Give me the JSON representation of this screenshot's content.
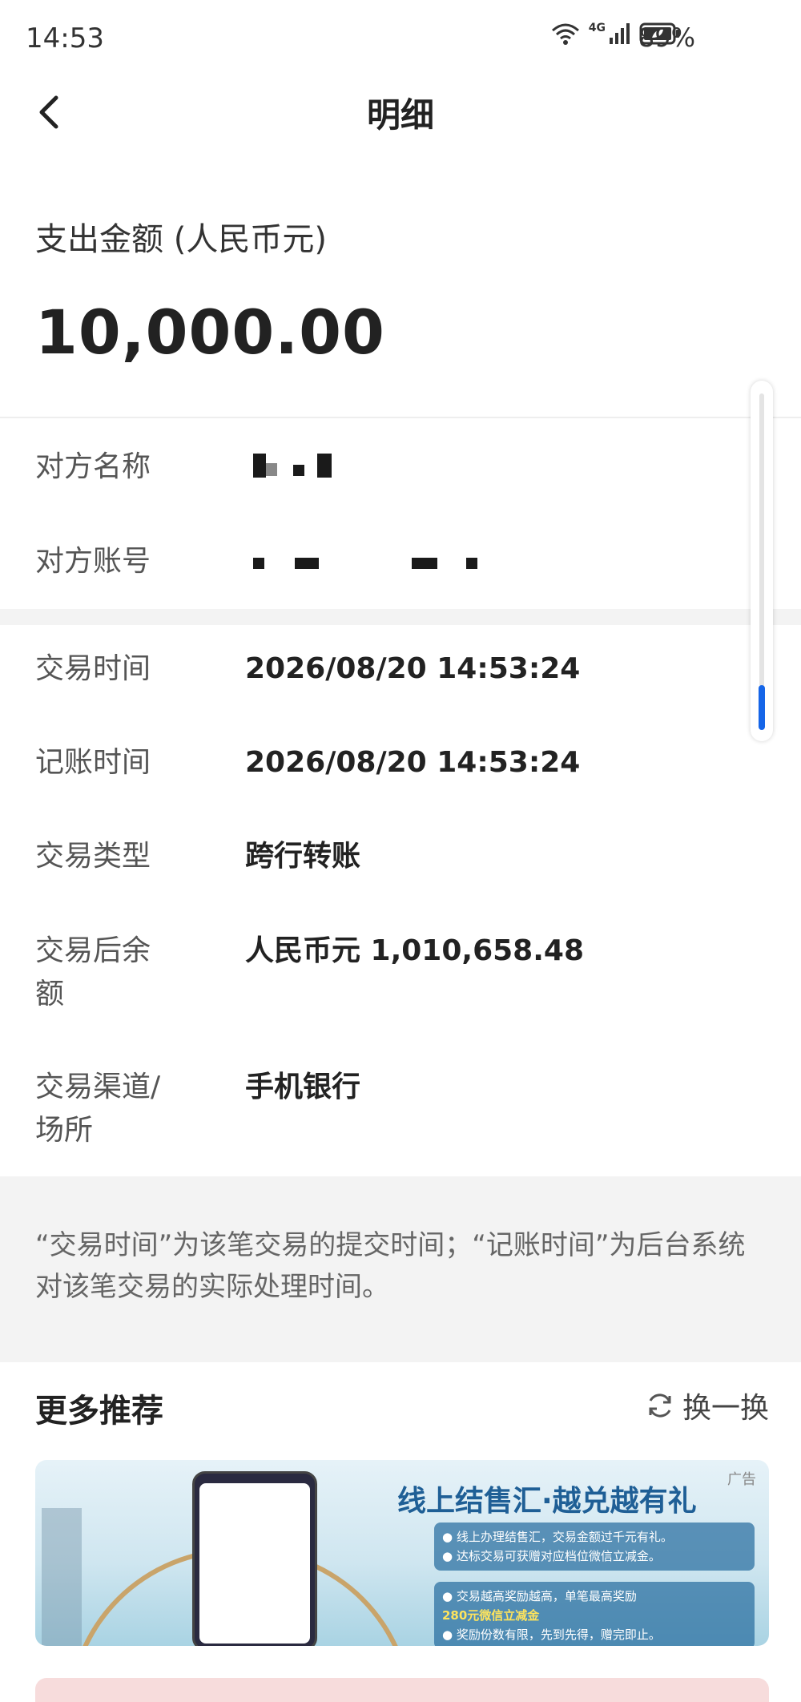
{
  "status_bar": {
    "time": "14:53",
    "network": "4G",
    "battery_percent": "89%"
  },
  "header": {
    "title": "明细"
  },
  "amount": {
    "label": "支出金额 (人民币元)",
    "value": "10,000.00"
  },
  "details": [
    {
      "label": "对方名称",
      "value": ""
    },
    {
      "label": "对方账号",
      "value": ""
    },
    {
      "label": "交易时间",
      "value": "2026/08/20 14:53:24"
    },
    {
      "label": "记账时间",
      "value": "2026/08/20 14:53:24"
    },
    {
      "label": "交易类型",
      "value": "跨行转账"
    },
    {
      "label": "交易后余额",
      "value": "人民币元 1,010,658.48"
    },
    {
      "label": "交易渠道/场所",
      "value": "手机银行"
    }
  ],
  "note": "“交易时间”为该笔交易的提交时间；“记账时间”为后台系统对该笔交易的实际处理时间。",
  "recommend": {
    "title": "更多推荐",
    "refresh_label": "换一换",
    "banner": {
      "ad_tag": "广告",
      "headline": "线上结售汇·越兑越有礼",
      "box1_line1": "● 线上办理结售汇，交易金额过千元有礼。",
      "box1_line2": "● 达标交易可获赠对应档位微信立减金。",
      "box2_line1": "● 交易越高奖励越高，单笔最高奖励",
      "box2_highlight": "280元微信立减金",
      "box2_line2": "● 奖励份数有限，先到先得，赠完即止。"
    }
  },
  "colors": {
    "accent_blue": "#1565e8",
    "band_gray": "#f3f3f3"
  }
}
